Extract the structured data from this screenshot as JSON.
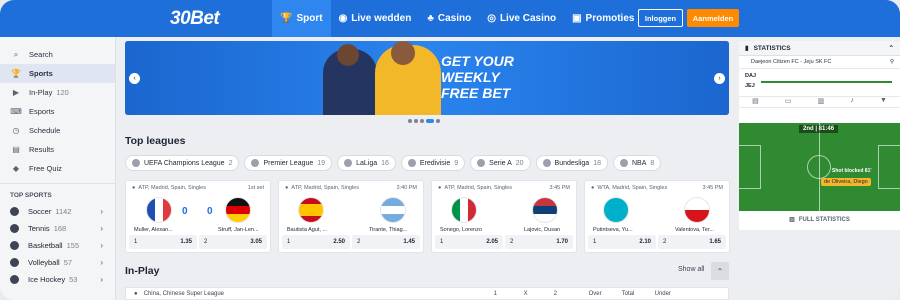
{
  "header": {
    "logo": "30Bet",
    "nav": [
      {
        "label": "Sport",
        "icon": "trophy-icon",
        "glyph": "🏆"
      },
      {
        "label": "Live wedden",
        "icon": "live-icon",
        "glyph": "◉"
      },
      {
        "label": "Casino",
        "icon": "cards-icon",
        "glyph": "♣"
      },
      {
        "label": "Live Casino",
        "icon": "dealer-icon",
        "glyph": "◎"
      },
      {
        "label": "Promoties",
        "icon": "gift-icon",
        "glyph": "▣"
      }
    ],
    "login": "Inloggen",
    "register": "Aanmelden",
    "brand_color": "#1e6fd9",
    "accent_color": "#ff8a00"
  },
  "sidebar": {
    "items": [
      {
        "label": "Search",
        "glyph": "⌕"
      },
      {
        "label": "Sports",
        "glyph": "🏆"
      },
      {
        "label": "In-Play",
        "count": "120",
        "glyph": "▶"
      },
      {
        "label": "Esports",
        "glyph": "⌨"
      },
      {
        "label": "Schedule",
        "glyph": "◷"
      },
      {
        "label": "Results",
        "glyph": "▤"
      },
      {
        "label": "Free Quiz",
        "glyph": "◆"
      }
    ],
    "top_sports_label": "TOP SPORTS",
    "sports": [
      {
        "label": "Soccer",
        "count": "1142"
      },
      {
        "label": "Tennis",
        "count": "168"
      },
      {
        "label": "Basketball",
        "count": "155"
      },
      {
        "label": "Volleyball",
        "count": "57"
      },
      {
        "label": "Ice Hockey",
        "count": "53"
      }
    ]
  },
  "banner": {
    "line1": "GET YOUR",
    "line2": "WEEKLY",
    "line3": "FREE BET",
    "pages": 5,
    "active_page": 3
  },
  "top_leagues": {
    "title": "Top leagues",
    "chips": [
      {
        "label": "UEFA Champions League",
        "count": "2"
      },
      {
        "label": "Premier League",
        "count": "19"
      },
      {
        "label": "LaLiga",
        "count": "16"
      },
      {
        "label": "Eredivisie",
        "count": "9"
      },
      {
        "label": "Serie A",
        "count": "20"
      },
      {
        "label": "Bundesliga",
        "count": "18"
      },
      {
        "label": "NBA",
        "count": "8"
      }
    ]
  },
  "matches": [
    {
      "league": "ATP, Madrid, Spain, Singles",
      "time": "1st set",
      "home": "Muller, Alexan...",
      "away": "Struff, Jan-Len...",
      "home_score": "0",
      "away_score": "0",
      "odds": [
        {
          "k": "1",
          "v": "1.35"
        },
        {
          "k": "2",
          "v": "3.05"
        }
      ]
    },
    {
      "league": "ATP, Madrid, Spain, Singles",
      "time": "3:40 PM",
      "home": "Bautista Agut, ...",
      "away": "Tirante, Thiag...",
      "odds": [
        {
          "k": "1",
          "v": "2.50"
        },
        {
          "k": "2",
          "v": "1.45"
        }
      ]
    },
    {
      "league": "ATP, Madrid, Spain, Singles",
      "time": "3:45 PM",
      "home": "Sonego, Lorenzo",
      "away": "Lajovic, Dusan",
      "odds": [
        {
          "k": "1",
          "v": "2.05"
        },
        {
          "k": "2",
          "v": "1.70"
        }
      ]
    },
    {
      "league": "WTA, Madrid, Spain, Singles",
      "time": "3:45 PM",
      "home": "Putintseva, Yu...",
      "away": "Valentova, Ter...",
      "odds": [
        {
          "k": "1",
          "v": "2.10"
        },
        {
          "k": "2",
          "v": "1.65"
        }
      ]
    }
  ],
  "inplay": {
    "title": "In-Play",
    "show_all": "Show all",
    "row": {
      "league": "China, Chinese Super League",
      "cols": [
        "1",
        "X",
        "2",
        "Over",
        "Total",
        "Under"
      ]
    }
  },
  "statistics": {
    "title": "STATISTICS",
    "match": "Daejeon Citizen FC - Jeju SK FC",
    "team1": "DAJ",
    "team2": "JEJ",
    "clock": "2nd | 81:46",
    "event": "Shot blocked",
    "event_minute": "81'",
    "player": "de Oliveira, Diego",
    "full_stats": "FULL STATISTICS"
  }
}
